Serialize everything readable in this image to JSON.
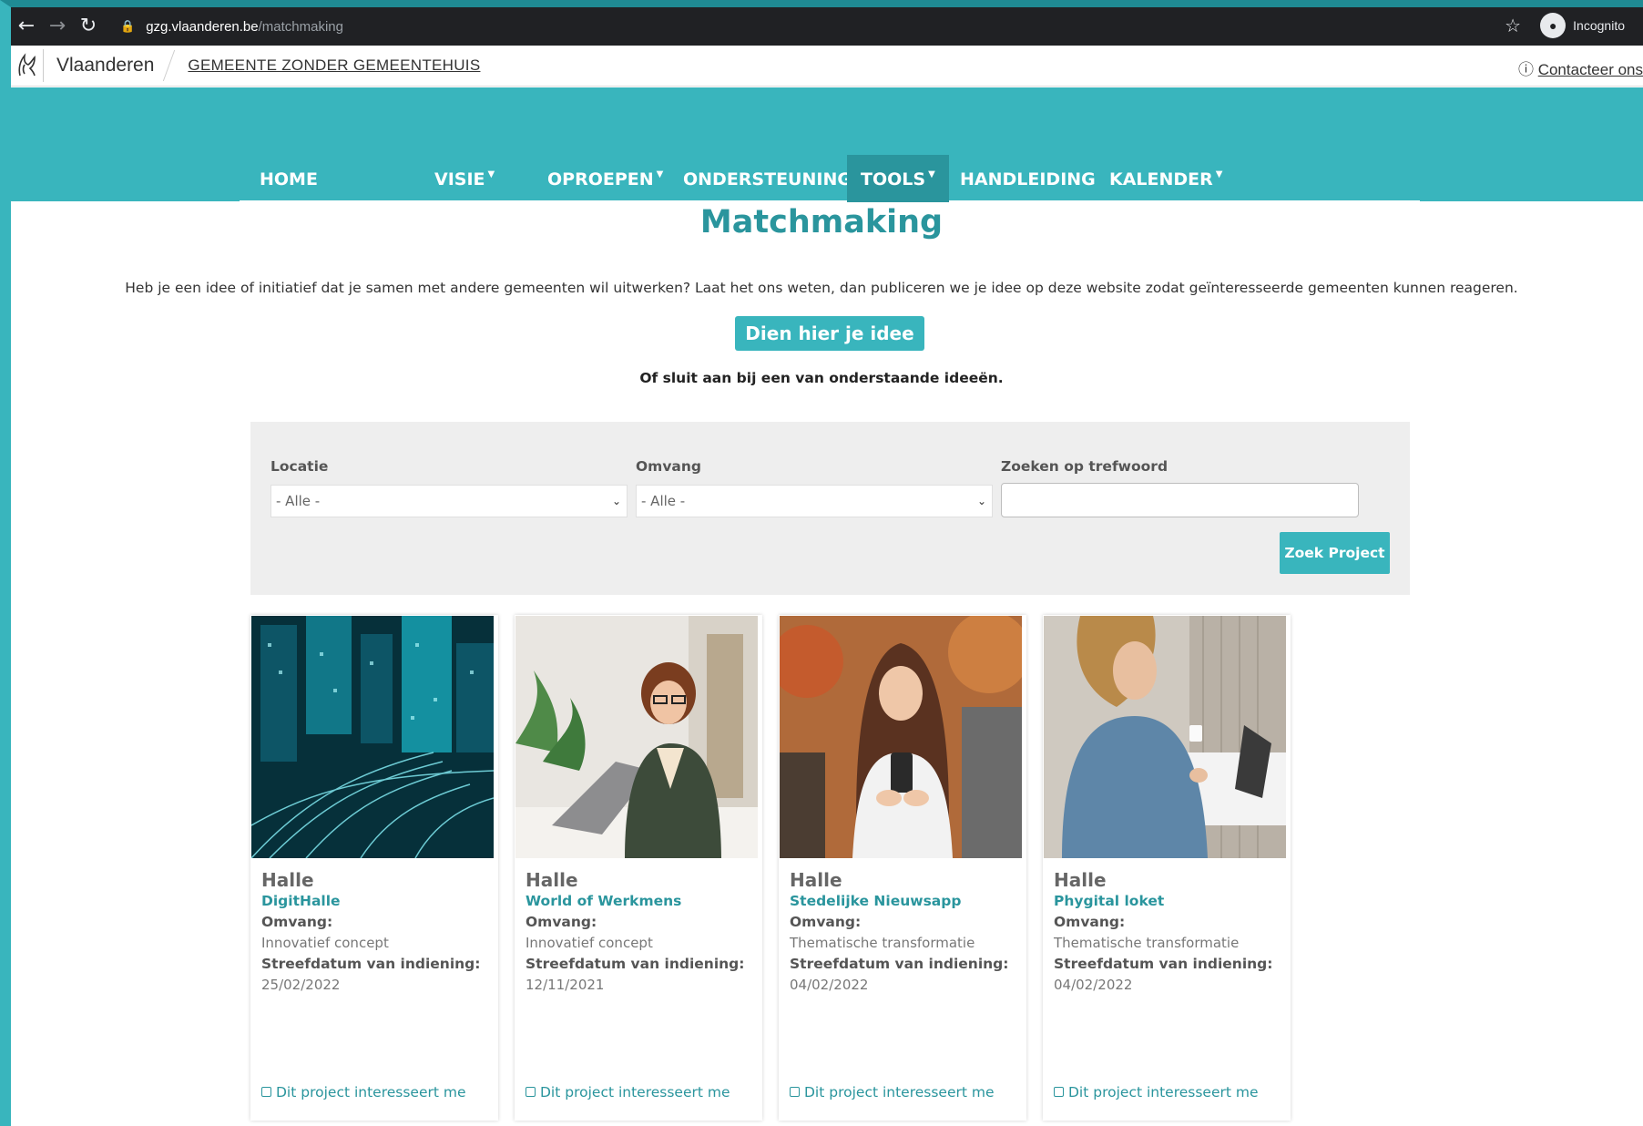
{
  "browser": {
    "url_domain": "gzg.vlaanderen.be",
    "url_path": "/matchmaking",
    "incognito_label": "Incognito"
  },
  "header": {
    "brand": "Vlaanderen",
    "site_name": "GEMEENTE ZONDER GEMEENTEHUIS",
    "contact_label": "Contacteer ons"
  },
  "nav": {
    "items": [
      {
        "label": "HOME"
      },
      {
        "label": "VISIE"
      },
      {
        "label": "OPROEPEN"
      },
      {
        "label": "ONDERSTEUNING"
      },
      {
        "label": "TOOLS"
      },
      {
        "label": "HANDLEIDING"
      },
      {
        "label": "KALENDER"
      }
    ],
    "active": "TOOLS"
  },
  "main": {
    "title": "Matchmaking",
    "intro": "Heb je een idee of initiatief dat je samen met andere gemeenten wil uitwerken? Laat het ons weten, dan publiceren we je idee op deze website zodat geïnteresseerde gemeenten kunnen reageren.",
    "cta_label": "Dien hier je idee in",
    "subheading": "Of sluit aan bij een van onderstaande ideeën."
  },
  "filters": {
    "locatie_label": "Locatie",
    "locatie_value": "- Alle -",
    "omvang_label": "Omvang",
    "omvang_value": "- Alle -",
    "search_label": "Zoeken op trefwoord",
    "search_value": "",
    "submit_label": "Zoek Project"
  },
  "card_labels": {
    "omvang": "Omvang:",
    "deadline": "Streefdatum van indiening:",
    "interest": "Dit project interesseert me"
  },
  "cards": [
    {
      "location": "Halle",
      "name": "DigitHalle",
      "omvang": "Innovatief concept",
      "date": "25/02/2022",
      "image": "city-lights-photo"
    },
    {
      "location": "Halle",
      "name": "World of Werkmens",
      "omvang": "Innovatief concept",
      "date": "12/11/2021",
      "image": "woman-laptop-photo"
    },
    {
      "location": "Halle",
      "name": "Stedelijke Nieuwsapp",
      "omvang": "Thematische transformatie",
      "date": "04/02/2022",
      "image": "woman-phone-photo"
    },
    {
      "location": "Halle",
      "name": "Phygital loket",
      "omvang": "Thematische transformatie",
      "date": "04/02/2022",
      "image": "woman-laptop-cafe-photo"
    }
  ],
  "colors": {
    "accent": "#39b5bd",
    "accent_dark": "#2a959d"
  }
}
